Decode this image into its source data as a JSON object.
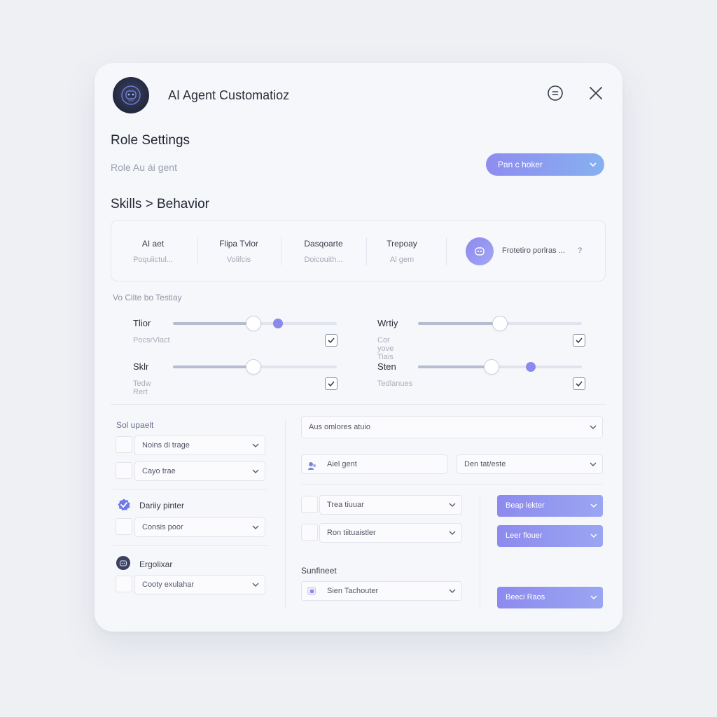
{
  "header": {
    "title": "AI Agent Customatioz"
  },
  "role": {
    "heading": "Role Settings",
    "field_placeholder": "Role Au ái gent",
    "pill_label": "Pan c hoker"
  },
  "skills": {
    "heading": "Skills > Behavior",
    "columns": [
      {
        "title": "AI aet",
        "sub": "Poquiictul..."
      },
      {
        "title": "Flipa Tvlor",
        "sub": "Volifcis"
      },
      {
        "title": "Dasqoarte",
        "sub": "Doicouith..."
      },
      {
        "title": "Trepoay",
        "sub": "Al gem"
      }
    ],
    "extra_label": "Frotetiro porlras ...",
    "extra_mark": "?"
  },
  "sliders": {
    "section_label": "Vo Cilte bo Testiay",
    "items": [
      {
        "label": "Tlior",
        "sub": "PocsrVlact",
        "level": 0.49,
        "secondary": 0.64,
        "checked": true
      },
      {
        "label": "Wrtiy",
        "sub": "Cor yove Tiais",
        "level": 0.5,
        "secondary": null,
        "checked": true
      },
      {
        "label": "Sklr",
        "sub": "Tedw Rert",
        "level": 0.49,
        "secondary": null,
        "checked": true
      },
      {
        "label": "Sten",
        "sub": "Tedlanues",
        "level": 0.45,
        "secondary": 0.69,
        "checked": true
      }
    ]
  },
  "left_panel": {
    "group1_label": "Sol upaelt",
    "group1_selects": [
      "Noins di trage",
      "Cayo trae"
    ],
    "group2_label": "Dariiy pinter",
    "group2_select": "Consis poor",
    "group3_label": "Ergolixar",
    "group3_select": "Cooty exulahar"
  },
  "right_panel": {
    "top_select": "Aus omlores atuio",
    "agent_field": "Aiel gent",
    "agent_select": "Den tat/este",
    "selects": [
      "Trea tiuuar",
      "Ron tiituaistler"
    ],
    "sub_label": "Sunfineet",
    "bottom_select": "Sien Tachouter",
    "purple_buttons": [
      "Beap lekter",
      "Leer flouer",
      "Beeci Raos"
    ]
  },
  "colors": {
    "accent": "#8b88ee",
    "pill_gradient_start": "#8f8cf0",
    "pill_gradient_end": "#86b0f0"
  }
}
